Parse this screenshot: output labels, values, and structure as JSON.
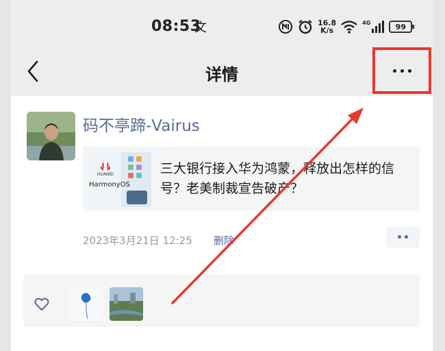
{
  "status_bar": {
    "time": "08:53",
    "extra_glyph": "文",
    "net_speed_value": "16.8",
    "net_speed_unit": "K/s",
    "network_type": "4G",
    "battery": "99"
  },
  "nav": {
    "title": "详情"
  },
  "post": {
    "author_name": "码不亭蹄-Vairus",
    "link_card": {
      "title": "三大银行接入华为鸿蒙，释放出怎样的信号？老美制裁宣告破产？",
      "thumb_brand": "HUAWEI",
      "thumb_text": "HarmonyOS"
    },
    "timestamp": "2023年3月21日 12:25",
    "delete_label": "删除"
  },
  "colors": {
    "link_blue": "#576b95",
    "highlight_red": "#e8372f"
  },
  "icons": [
    "back-arrow-icon",
    "more-dots-icon",
    "heart-icon",
    "wifi-icon",
    "alarm-icon",
    "signal-icon",
    "battery-icon"
  ]
}
